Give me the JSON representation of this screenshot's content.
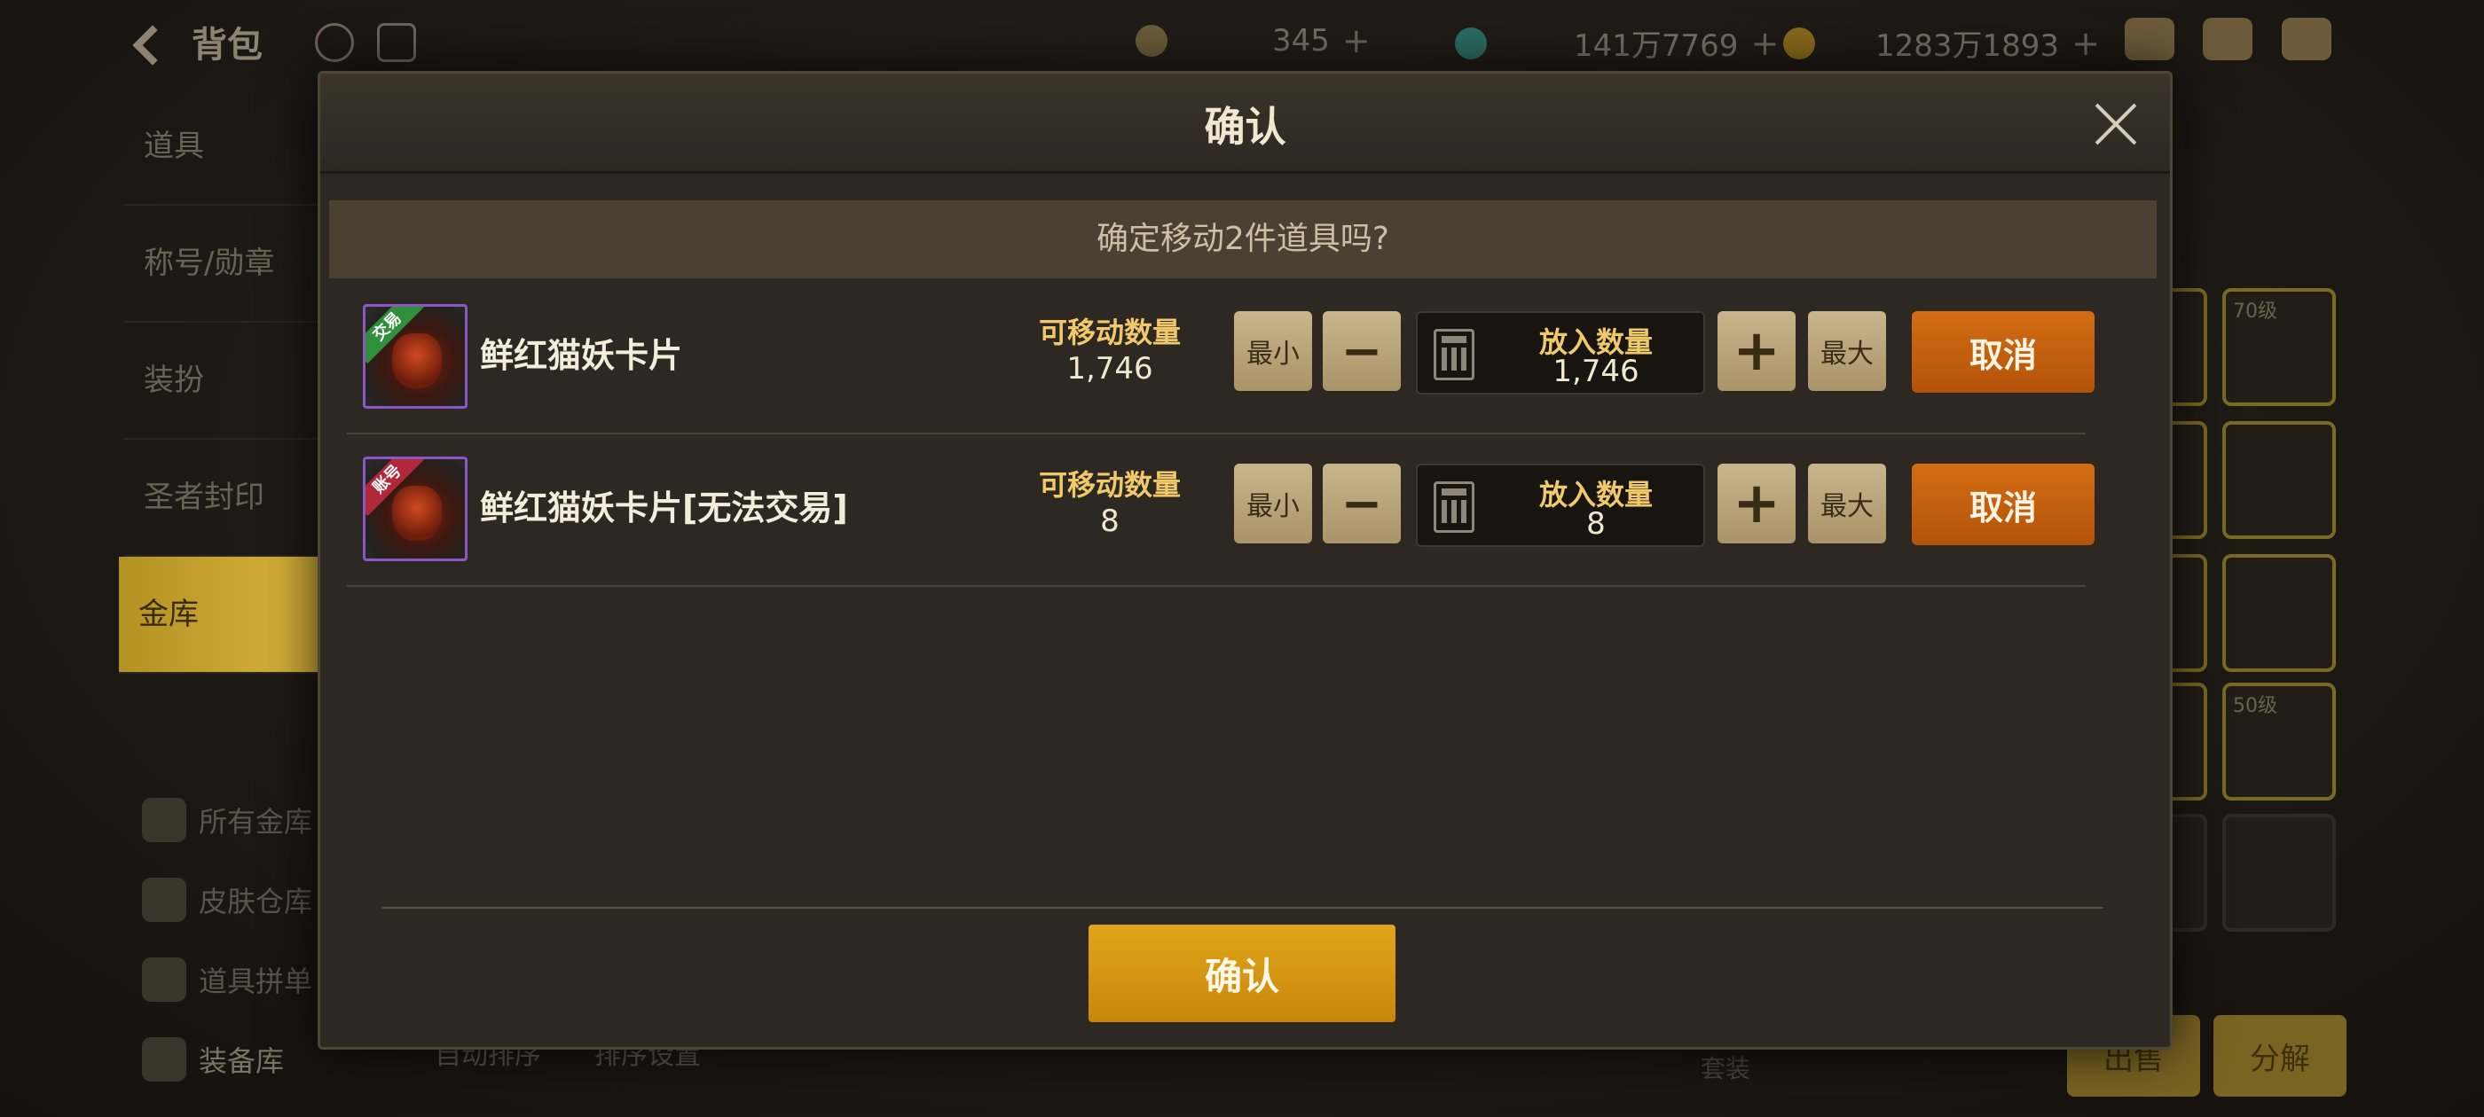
{
  "background": {
    "title": "背包",
    "currencies": [
      {
        "value": "345"
      },
      {
        "value": "141万7769"
      },
      {
        "value": "1283万1893"
      }
    ],
    "side_menu": [
      "道具",
      "称号/勋章",
      "装扮",
      "圣者封印",
      "金库"
    ],
    "sub_menu": [
      "所有金库",
      "皮肤仓库",
      "道具拼单",
      "装备库"
    ],
    "bottom_actions": [
      "自动排序",
      "排序设置"
    ],
    "dropdown": "套装",
    "right_buttons": [
      "出售",
      "分解"
    ],
    "grid_labels": [
      "70级",
      "50级"
    ]
  },
  "modal": {
    "title": "确认",
    "question": "确定移动2件道具吗?",
    "items": [
      {
        "name": "鲜红猫妖卡片",
        "tag": "交易",
        "movable_label": "可移动数量",
        "movable_value": "1,746",
        "min_label": "最小",
        "minus_label": "−",
        "qty_label": "放入数量",
        "qty_value": "1,746",
        "plus_label": "+",
        "max_label": "最大",
        "cancel_label": "取消"
      },
      {
        "name": "鲜红猫妖卡片[无法交易]",
        "tag": "账号",
        "movable_label": "可移动数量",
        "movable_value": "8",
        "min_label": "最小",
        "minus_label": "−",
        "qty_label": "放入数量",
        "qty_value": "8",
        "plus_label": "+",
        "max_label": "最大",
        "cancel_label": "取消"
      }
    ],
    "confirm_label": "确认"
  },
  "colors": {
    "accent_gold": "#e0a51c",
    "cancel_orange": "#c8620f",
    "label_gold": "#f0c96a",
    "tag_trade": "#2f8f3a",
    "tag_account": "#b0283a"
  }
}
